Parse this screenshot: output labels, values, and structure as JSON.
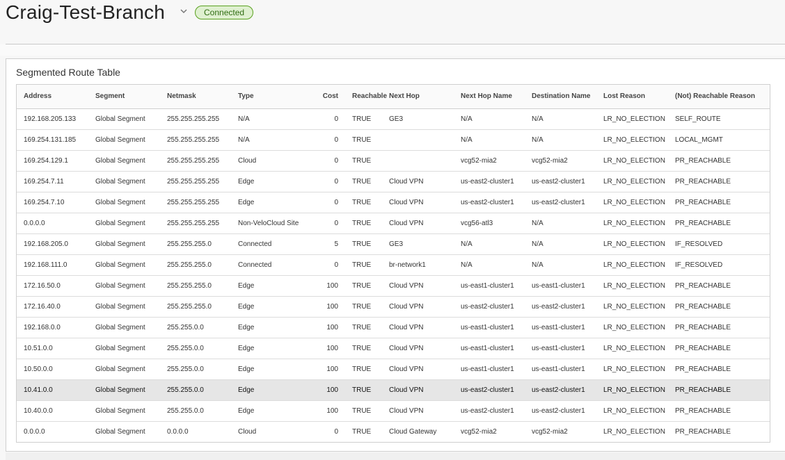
{
  "header": {
    "title": "Craig-Test-Branch",
    "status": "Connected"
  },
  "colors": {
    "status_badge_border": "#5aa220",
    "status_badge_bg": "#dff0d0",
    "selected_row": "#e6e6e6"
  },
  "icons": {
    "title_dropdown": "chevron-down-icon"
  },
  "card": {
    "title": "Segmented Route Table"
  },
  "table": {
    "columns": {
      "address": "Address",
      "segment": "Segment",
      "netmask": "Netmask",
      "type": "Type",
      "cost": "Cost",
      "reachable": "Reachable",
      "next_hop": "Next Hop",
      "next_hop_name": "Next Hop Name",
      "destination_name": "Destination Name",
      "lost_reason": "Lost Reason",
      "not_reachable_reason": "(Not) Reachable Reason"
    },
    "selected_row": "10.41.0.0",
    "rows": [
      {
        "address": "192.168.205.133",
        "segment": "Global Segment",
        "netmask": "255.255.255.255",
        "type": "N/A",
        "cost": "0",
        "reachable": "TRUE",
        "next_hop": "GE3",
        "next_hop_name": "N/A",
        "destination_name": "N/A",
        "lost_reason": "LR_NO_ELECTION",
        "not_reachable_reason": "SELF_ROUTE"
      },
      {
        "address": "169.254.131.185",
        "segment": "Global Segment",
        "netmask": "255.255.255.255",
        "type": "N/A",
        "cost": "0",
        "reachable": "TRUE",
        "next_hop": "",
        "next_hop_name": "N/A",
        "destination_name": "N/A",
        "lost_reason": "LR_NO_ELECTION",
        "not_reachable_reason": "LOCAL_MGMT"
      },
      {
        "address": "169.254.129.1",
        "segment": "Global Segment",
        "netmask": "255.255.255.255",
        "type": "Cloud",
        "cost": "0",
        "reachable": "TRUE",
        "next_hop": "",
        "next_hop_name": "vcg52-mia2",
        "destination_name": "vcg52-mia2",
        "lost_reason": "LR_NO_ELECTION",
        "not_reachable_reason": "PR_REACHABLE"
      },
      {
        "address": "169.254.7.11",
        "segment": "Global Segment",
        "netmask": "255.255.255.255",
        "type": "Edge",
        "cost": "0",
        "reachable": "TRUE",
        "next_hop": "Cloud VPN",
        "next_hop_name": "us-east2-cluster1",
        "destination_name": "us-east2-cluster1",
        "lost_reason": "LR_NO_ELECTION",
        "not_reachable_reason": "PR_REACHABLE"
      },
      {
        "address": "169.254.7.10",
        "segment": "Global Segment",
        "netmask": "255.255.255.255",
        "type": "Edge",
        "cost": "0",
        "reachable": "TRUE",
        "next_hop": "Cloud VPN",
        "next_hop_name": "us-east2-cluster1",
        "destination_name": "us-east2-cluster1",
        "lost_reason": "LR_NO_ELECTION",
        "not_reachable_reason": "PR_REACHABLE"
      },
      {
        "address": "0.0.0.0",
        "segment": "Global Segment",
        "netmask": "255.255.255.255",
        "type": "Non-VeloCloud Site",
        "cost": "0",
        "reachable": "TRUE",
        "next_hop": "Cloud VPN",
        "next_hop_name": "vcg56-atl3",
        "destination_name": "N/A",
        "lost_reason": "LR_NO_ELECTION",
        "not_reachable_reason": "PR_REACHABLE"
      },
      {
        "address": "192.168.205.0",
        "segment": "Global Segment",
        "netmask": "255.255.255.0",
        "type": "Connected",
        "cost": "5",
        "reachable": "TRUE",
        "next_hop": "GE3",
        "next_hop_name": "N/A",
        "destination_name": "N/A",
        "lost_reason": "LR_NO_ELECTION",
        "not_reachable_reason": "IF_RESOLVED"
      },
      {
        "address": "192.168.111.0",
        "segment": "Global Segment",
        "netmask": "255.255.255.0",
        "type": "Connected",
        "cost": "0",
        "reachable": "TRUE",
        "next_hop": "br-network1",
        "next_hop_name": "N/A",
        "destination_name": "N/A",
        "lost_reason": "LR_NO_ELECTION",
        "not_reachable_reason": "IF_RESOLVED"
      },
      {
        "address": "172.16.50.0",
        "segment": "Global Segment",
        "netmask": "255.255.255.0",
        "type": "Edge",
        "cost": "100",
        "reachable": "TRUE",
        "next_hop": "Cloud VPN",
        "next_hop_name": "us-east1-cluster1",
        "destination_name": "us-east1-cluster1",
        "lost_reason": "LR_NO_ELECTION",
        "not_reachable_reason": "PR_REACHABLE"
      },
      {
        "address": "172.16.40.0",
        "segment": "Global Segment",
        "netmask": "255.255.255.0",
        "type": "Edge",
        "cost": "100",
        "reachable": "TRUE",
        "next_hop": "Cloud VPN",
        "next_hop_name": "us-east2-cluster1",
        "destination_name": "us-east2-cluster1",
        "lost_reason": "LR_NO_ELECTION",
        "not_reachable_reason": "PR_REACHABLE"
      },
      {
        "address": "192.168.0.0",
        "segment": "Global Segment",
        "netmask": "255.255.0.0",
        "type": "Edge",
        "cost": "100",
        "reachable": "TRUE",
        "next_hop": "Cloud VPN",
        "next_hop_name": "us-east1-cluster1",
        "destination_name": "us-east1-cluster1",
        "lost_reason": "LR_NO_ELECTION",
        "not_reachable_reason": "PR_REACHABLE"
      },
      {
        "address": "10.51.0.0",
        "segment": "Global Segment",
        "netmask": "255.255.0.0",
        "type": "Edge",
        "cost": "100",
        "reachable": "TRUE",
        "next_hop": "Cloud VPN",
        "next_hop_name": "us-east1-cluster1",
        "destination_name": "us-east1-cluster1",
        "lost_reason": "LR_NO_ELECTION",
        "not_reachable_reason": "PR_REACHABLE"
      },
      {
        "address": "10.50.0.0",
        "segment": "Global Segment",
        "netmask": "255.255.0.0",
        "type": "Edge",
        "cost": "100",
        "reachable": "TRUE",
        "next_hop": "Cloud VPN",
        "next_hop_name": "us-east1-cluster1",
        "destination_name": "us-east1-cluster1",
        "lost_reason": "LR_NO_ELECTION",
        "not_reachable_reason": "PR_REACHABLE"
      },
      {
        "address": "10.41.0.0",
        "segment": "Global Segment",
        "netmask": "255.255.0.0",
        "type": "Edge",
        "cost": "100",
        "reachable": "TRUE",
        "next_hop": "Cloud VPN",
        "next_hop_name": "us-east2-cluster1",
        "destination_name": "us-east2-cluster1",
        "lost_reason": "LR_NO_ELECTION",
        "not_reachable_reason": "PR_REACHABLE"
      },
      {
        "address": "10.40.0.0",
        "segment": "Global Segment",
        "netmask": "255.255.0.0",
        "type": "Edge",
        "cost": "100",
        "reachable": "TRUE",
        "next_hop": "Cloud VPN",
        "next_hop_name": "us-east2-cluster1",
        "destination_name": "us-east2-cluster1",
        "lost_reason": "LR_NO_ELECTION",
        "not_reachable_reason": "PR_REACHABLE"
      },
      {
        "address": "0.0.0.0",
        "segment": "Global Segment",
        "netmask": "0.0.0.0",
        "type": "Cloud",
        "cost": "0",
        "reachable": "TRUE",
        "next_hop": "Cloud Gateway",
        "next_hop_name": "vcg52-mia2",
        "destination_name": "vcg52-mia2",
        "lost_reason": "LR_NO_ELECTION",
        "not_reachable_reason": "PR_REACHABLE"
      }
    ]
  }
}
